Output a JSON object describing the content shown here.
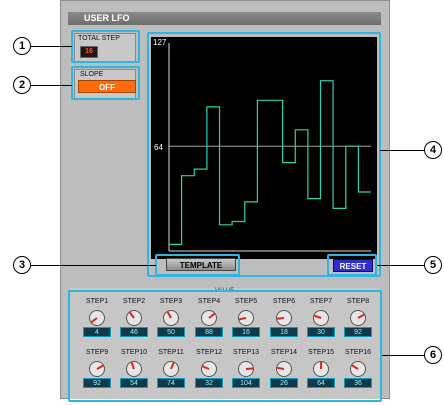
{
  "title": "USER LFO",
  "total_step": {
    "label": "TOTAL STEP",
    "value": "16"
  },
  "slope": {
    "label": "SLOPE",
    "value": "OFF"
  },
  "graph": {
    "y_max_label": "127",
    "y_mid_label": "64",
    "step_values": [
      4,
      46,
      50,
      88,
      16,
      18,
      30,
      92,
      92,
      54,
      74,
      32,
      104,
      26,
      64,
      36
    ]
  },
  "template_button": "TEMPLATE",
  "reset_button": "RESET",
  "value_panel": {
    "title": "VALUE",
    "steps": [
      {
        "label": "STEP1",
        "value": "4"
      },
      {
        "label": "STEP2",
        "value": "46"
      },
      {
        "label": "STEP3",
        "value": "50"
      },
      {
        "label": "STEP4",
        "value": "88"
      },
      {
        "label": "STEP5",
        "value": "16"
      },
      {
        "label": "STEP6",
        "value": "18"
      },
      {
        "label": "STEP7",
        "value": "30"
      },
      {
        "label": "STEP8",
        "value": "92"
      },
      {
        "label": "STEP9",
        "value": "92"
      },
      {
        "label": "STEP10",
        "value": "54"
      },
      {
        "label": "STEP11",
        "value": "74"
      },
      {
        "label": "STEP12",
        "value": "32"
      },
      {
        "label": "STEP13",
        "value": "104"
      },
      {
        "label": "STEP14",
        "value": "26"
      },
      {
        "label": "STEP15",
        "value": "64"
      },
      {
        "label": "STEP16",
        "value": "36"
      }
    ]
  },
  "callouts": [
    "1",
    "2",
    "3",
    "4",
    "5",
    "6"
  ],
  "colors": {
    "highlight": "#2fb6e0",
    "graph_line": "#2ad3b0",
    "slope_orange": "#ff6a0a",
    "reset_blue": "#2e2ed0"
  }
}
